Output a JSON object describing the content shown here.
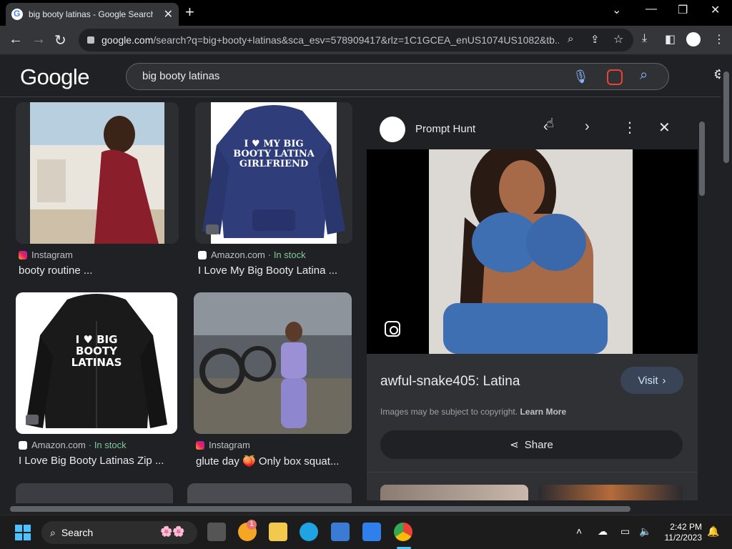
{
  "browser": {
    "tab_title": "big booty latinas - Google Search",
    "new_tab": "+",
    "url_host": "google.com",
    "url_rest": "/search?q=big+booty+latinas&sca_esv=578909417&rlz=1C1GCEA_enUS1074US1082&tb..."
  },
  "google": {
    "logo": "Google",
    "query": "big booty latinas"
  },
  "results": [
    {
      "source": "Instagram",
      "stock": "",
      "caption": "booty routine ..."
    },
    {
      "source": "Amazon.com",
      "stock": "· In stock",
      "caption": "I Love My Big Booty Latina ..."
    },
    {
      "source": "Amazon.com",
      "stock": "· In stock",
      "caption": "I Love Big Booty Latinas Zip ..."
    },
    {
      "source": "Instagram",
      "stock": "",
      "caption": "glute day 🍑 Only box squat..."
    }
  ],
  "shirts": {
    "blue_text": "I ♥ MY BIG BOOTY LATINA GIRLFRIEND",
    "black_text": "I ♥ BIG BOOTY LATINAS"
  },
  "panel": {
    "site_name": "Prompt Hunt",
    "title": "awful-snake405: Latina",
    "visit_label": "Visit",
    "copyright": "Images may be subject to copyright.",
    "learn_more": "Learn More",
    "share_label": "Share"
  },
  "taskbar": {
    "search_label": "Search",
    "badge": "1",
    "time": "2:42 PM",
    "date": "11/2/2023"
  },
  "colors": {
    "background": "#202124",
    "in_stock": "#81c995",
    "visit_bg": "#394457"
  }
}
